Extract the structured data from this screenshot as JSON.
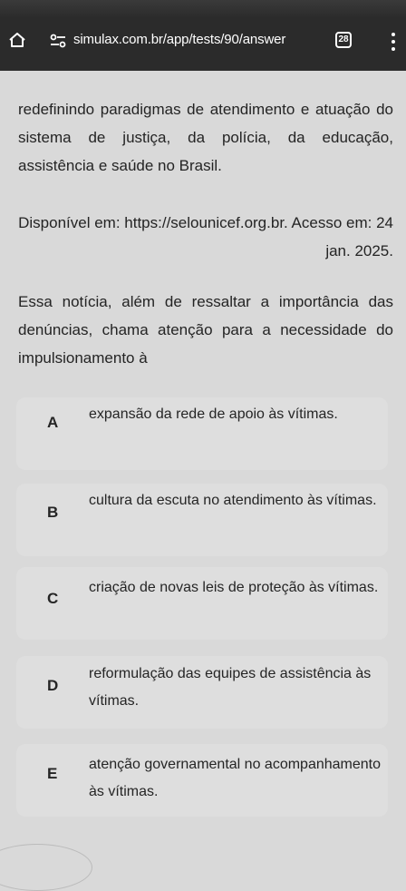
{
  "browser": {
    "url": "simulax.com.br/app/tests/90/answer",
    "tab_count": "28",
    "home_icon": "home-icon",
    "site_icon": "site-info-icon",
    "menu_icon": "vertical-dots-icon"
  },
  "article": {
    "paragraph1": "redefinindo paradigmas de atendimento e atuação do sistema de justiça, da polícia, da educação, assistência e saúde no Brasil.",
    "source": "Disponível em: https://selounicef.org.br. Acesso em: 24 jan. 2025.",
    "question": "Essa notícia, além de ressaltar a importância das denúncias, chama atenção para a necessidade do impulsionamento à"
  },
  "options": [
    {
      "letter": "A",
      "text": "expansão da rede de apoio às vítimas."
    },
    {
      "letter": "B",
      "text": "cultura da escuta no atendimento às vítimas."
    },
    {
      "letter": "C",
      "text": "criação de novas leis de proteção às vítimas."
    },
    {
      "letter": "D",
      "text": "reformulação das equipes de assistência às vítimas."
    },
    {
      "letter": "E",
      "text": "atenção governamental no acompanhamento às vítimas."
    }
  ],
  "colors": {
    "browser_bar": "#2b2b2b",
    "page_background": "#d9d9d9",
    "text": "#242424"
  }
}
